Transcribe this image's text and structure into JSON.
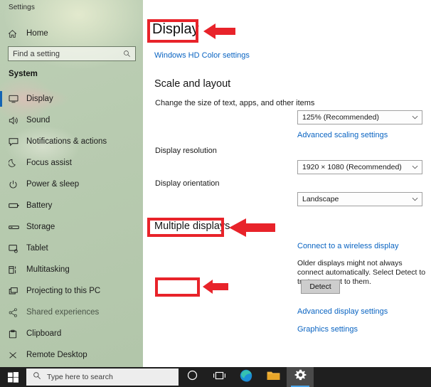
{
  "window": {
    "title": "Settings"
  },
  "sidebar": {
    "home": {
      "label": "Home",
      "icon": "home-icon"
    },
    "search": {
      "placeholder": "Find a setting",
      "icon": "search-icon"
    },
    "group_header": "System",
    "items": [
      {
        "label": "Display",
        "icon": "monitor-icon",
        "active": true
      },
      {
        "label": "Sound",
        "icon": "speaker-icon",
        "active": false
      },
      {
        "label": "Notifications & actions",
        "icon": "notification-icon",
        "active": false
      },
      {
        "label": "Focus assist",
        "icon": "moon-icon",
        "active": false
      },
      {
        "label": "Power & sleep",
        "icon": "power-icon",
        "active": false
      },
      {
        "label": "Battery",
        "icon": "battery-icon",
        "active": false
      },
      {
        "label": "Storage",
        "icon": "storage-icon",
        "active": false
      },
      {
        "label": "Tablet",
        "icon": "tablet-icon",
        "active": false
      },
      {
        "label": "Multitasking",
        "icon": "multitasking-icon",
        "active": false
      },
      {
        "label": "Projecting to this PC",
        "icon": "project-icon",
        "active": false
      },
      {
        "label": "Shared experiences",
        "icon": "share-icon",
        "active": false
      },
      {
        "label": "Clipboard",
        "icon": "clipboard-icon",
        "active": false
      },
      {
        "label": "Remote Desktop",
        "icon": "remote-desktop-icon",
        "active": false
      }
    ]
  },
  "main": {
    "page_title": "Display",
    "hd_color_link": "Windows HD Color settings",
    "scale_section": {
      "heading": "Scale and layout",
      "scale_label": "Change the size of text, apps, and other items",
      "scale_value": "125% (Recommended)",
      "advanced_scaling_link": "Advanced scaling settings",
      "resolution_label": "Display resolution",
      "resolution_value": "1920 × 1080 (Recommended)",
      "orientation_label": "Display orientation",
      "orientation_value": "Landscape"
    },
    "multiple_displays": {
      "heading": "Multiple displays",
      "wireless_link": "Connect to a wireless display",
      "description": "Older displays might not always connect automatically. Select Detect to try to connect to them.",
      "detect_button": "Detect"
    },
    "advanced_display_link": "Advanced display settings",
    "graphics_settings_link": "Graphics settings"
  },
  "annotations": {
    "color": "#e8232a",
    "highlights": [
      "Display",
      "Multiple displays",
      "Detect"
    ],
    "arrows": [
      "arrow-to-display",
      "arrow-to-multiple-displays",
      "arrow-to-detect"
    ]
  },
  "taskbar": {
    "start_label": "start-button",
    "search_placeholder": "Type here to search",
    "buttons": [
      {
        "name": "cortana-button",
        "icon": "circle-icon"
      },
      {
        "name": "task-view-button",
        "icon": "task-view-icon"
      },
      {
        "name": "edge-button",
        "icon": "edge-icon"
      },
      {
        "name": "file-explorer-button",
        "icon": "folder-icon"
      },
      {
        "name": "settings-button",
        "icon": "gear-icon",
        "active": true
      }
    ],
    "accent_color": "#4aa3e8"
  }
}
